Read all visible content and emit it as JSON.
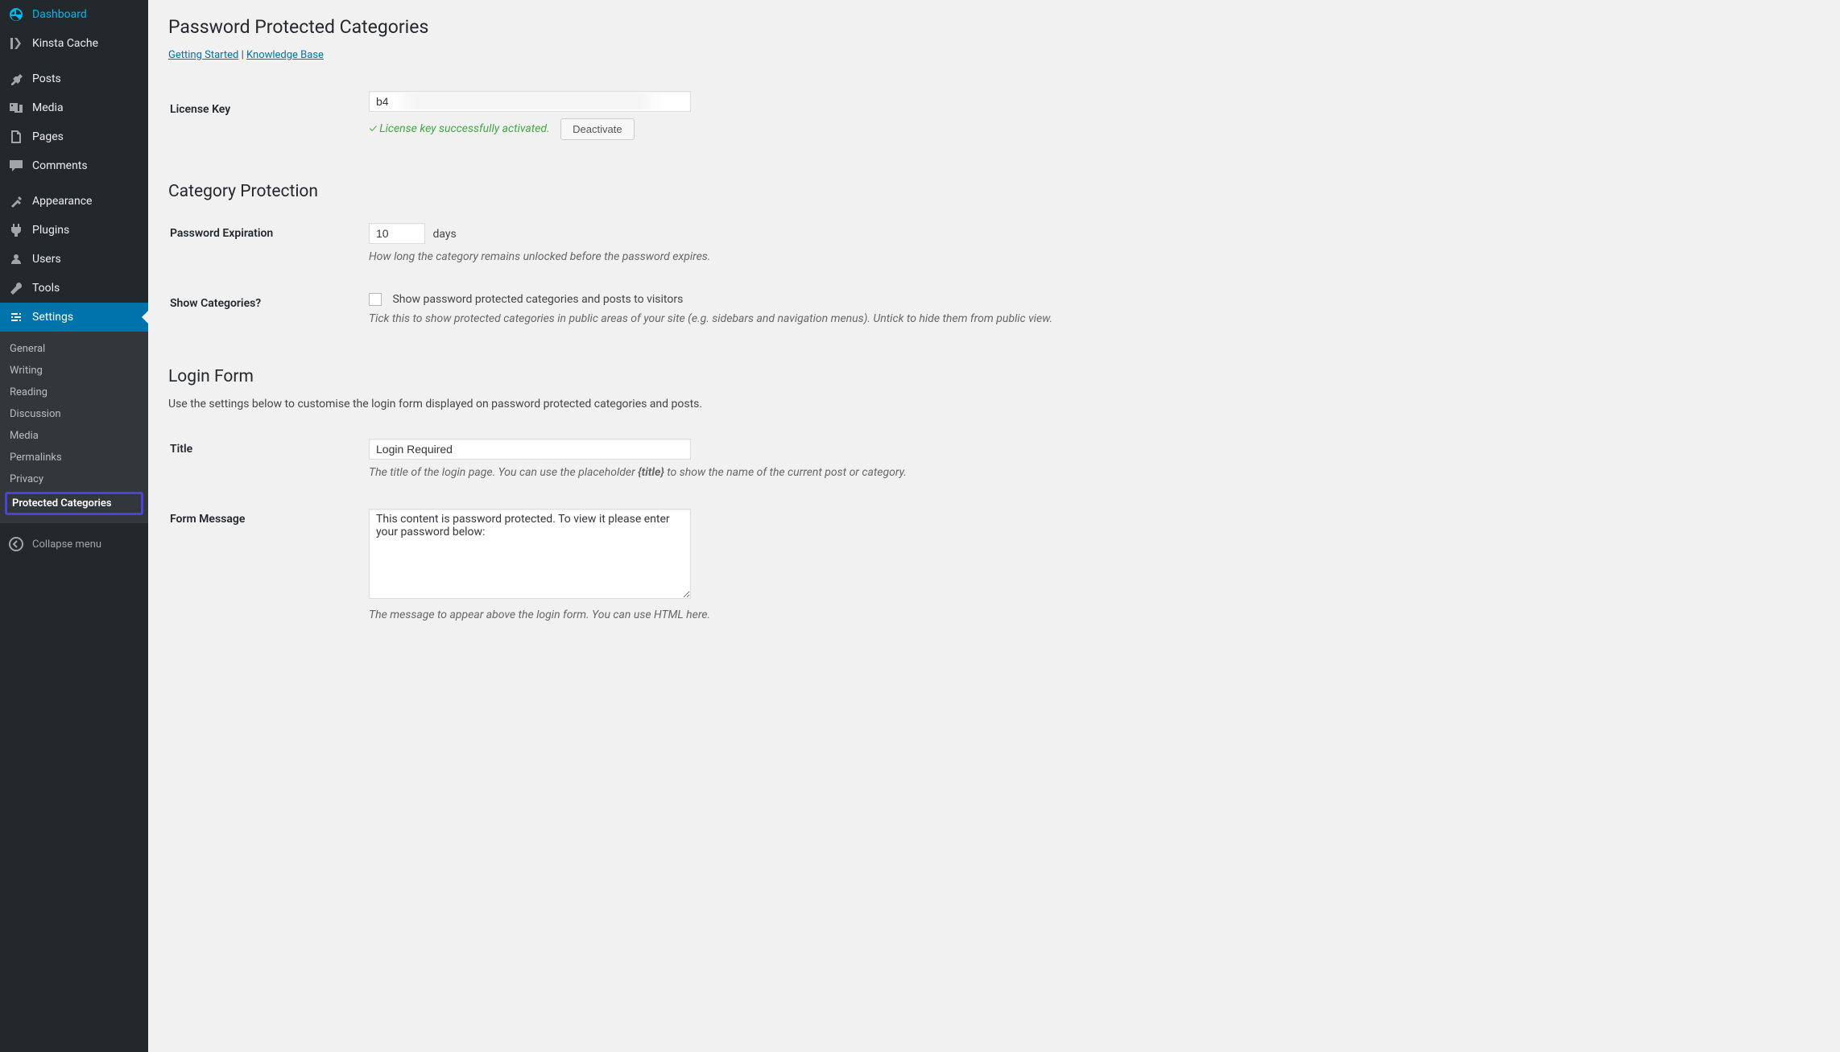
{
  "sidebar": {
    "items": [
      {
        "label": "Dashboard",
        "icon": "dashboard"
      },
      {
        "label": "Kinsta Cache",
        "icon": "kinsta"
      },
      {
        "label": "Posts",
        "icon": "pin"
      },
      {
        "label": "Media",
        "icon": "media"
      },
      {
        "label": "Pages",
        "icon": "pages"
      },
      {
        "label": "Comments",
        "icon": "comments"
      },
      {
        "label": "Appearance",
        "icon": "appearance"
      },
      {
        "label": "Plugins",
        "icon": "plugins"
      },
      {
        "label": "Users",
        "icon": "users"
      },
      {
        "label": "Tools",
        "icon": "tools"
      },
      {
        "label": "Settings",
        "icon": "settings"
      }
    ],
    "sub_items": [
      {
        "label": "General"
      },
      {
        "label": "Writing"
      },
      {
        "label": "Reading"
      },
      {
        "label": "Discussion"
      },
      {
        "label": "Media"
      },
      {
        "label": "Permalinks"
      },
      {
        "label": "Privacy"
      },
      {
        "label": "Protected Categories"
      }
    ],
    "collapse_label": "Collapse menu"
  },
  "page": {
    "title": "Password Protected Categories",
    "links": {
      "getting_started": "Getting Started",
      "knowledge_base": "Knowledge Base",
      "separator": " | "
    }
  },
  "license": {
    "label": "License Key",
    "value": "b4                                                            oa",
    "status": "✓ License key successfully activated.",
    "deactivate_label": "Deactivate"
  },
  "category_protection": {
    "title": "Category Protection",
    "expiration": {
      "label": "Password Expiration",
      "value": "10",
      "unit": "days",
      "desc": "How long the category remains unlocked before the password expires."
    },
    "show_categories": {
      "label": "Show Categories?",
      "checkbox_label": "Show password protected categories and posts to visitors",
      "desc": "Tick this to show protected categories in public areas of your site (e.g. sidebars and navigation menus). Untick to hide them from public view."
    }
  },
  "login_form": {
    "title": "Login Form",
    "desc": "Use the settings below to customise the login form displayed on password protected categories and posts.",
    "title_field": {
      "label": "Title",
      "value": "Login Required",
      "desc_part1": "The title of the login page. You can use the placeholder ",
      "desc_placeholder": "{title}",
      "desc_part2": " to show the name of the current post or category."
    },
    "message_field": {
      "label": "Form Message",
      "value": "This content is password protected. To view it please enter your password below:",
      "desc": "The message to appear above the login form. You can use HTML here."
    }
  }
}
